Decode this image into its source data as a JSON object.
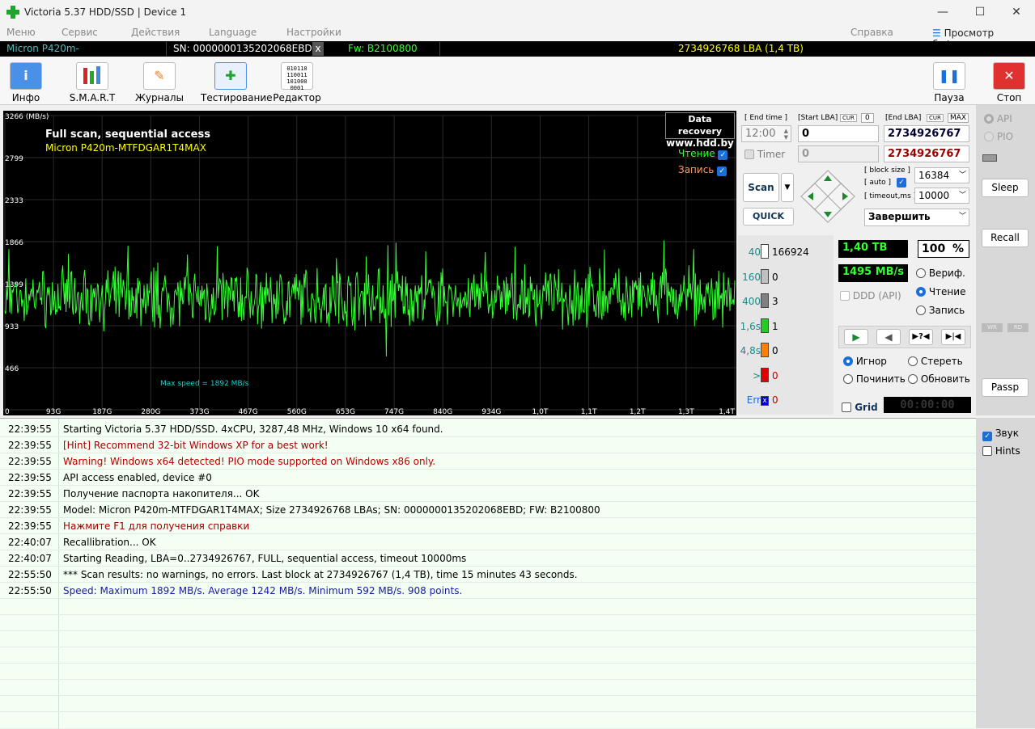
{
  "window": {
    "title": "Victoria 5.37 HDD/SSD | Device 1",
    "min_icon": "minimize-icon",
    "max_icon": "maximize-icon",
    "close_icon": "close-icon"
  },
  "menu": {
    "items": [
      "Меню",
      "Сервис",
      "Действия",
      "Language",
      "Настройки"
    ],
    "help": "Справка",
    "buffer": "Просмотр буфера"
  },
  "device": {
    "model": "Micron P420m-MTFDGAR1T4MAX",
    "sn": "SN: 0000000135202068EBD",
    "x": "x",
    "fw": "Fw: B2100800",
    "lba": "2734926768 LBA (1,4 TB)"
  },
  "toolbar": {
    "buttons": [
      {
        "label": "Инфо",
        "icon": "info-icon"
      },
      {
        "label": "S.M.A.R.T",
        "icon": "smart-icon"
      },
      {
        "label": "Журналы",
        "icon": "journal-icon"
      },
      {
        "label": "Тестирование",
        "icon": "testing-icon"
      },
      {
        "label": "Редактор",
        "icon": "editor-icon"
      }
    ],
    "pause": "Пауза",
    "stop": "Стоп"
  },
  "chart_data": {
    "type": "line",
    "title": "Full scan, sequential access",
    "subtitle": "Micron P420m-MTFDGAR1T4MAX",
    "ylabel": "3266 (MB/s)",
    "ylim": [
      0,
      3266
    ],
    "yticks": [
      "2799",
      "2333",
      "1866",
      "1399",
      "933",
      "466"
    ],
    "xticks": [
      "0",
      "93G",
      "187G",
      "280G",
      "373G",
      "467G",
      "560G",
      "653G",
      "747G",
      "840G",
      "934G",
      "1,0T",
      "1,1T",
      "1,2T",
      "1,3T",
      "1,4T"
    ],
    "max_label": "Max speed = 1892 MB/s",
    "legend": [
      {
        "name": "Чтение",
        "color": "#33ff33",
        "checked": true
      },
      {
        "name": "Запись",
        "color": "#ff9966",
        "checked": true
      }
    ],
    "grid": true,
    "series": [
      {
        "name": "Чтение",
        "color": "#33ff33",
        "points": 908,
        "max": 1892,
        "avg": 1242,
        "min": 592
      }
    ]
  },
  "watermark": {
    "line1": "Data recovery",
    "line2": "www.hdd.by"
  },
  "controls": {
    "end_time_lbl": "[ End time ]",
    "end_time": "12:00",
    "start_lba_lbl": "[Start LBA]",
    "cur": "CUR",
    "cur_val": "0",
    "start_lba": "0",
    "end_lba_lbl": "[End LBA]",
    "max": "MAX",
    "end_lba": "2734926767",
    "end_lba2": "2734926767",
    "timer_lbl": "Timer",
    "timer_val": "0",
    "scan": "Scan",
    "quick": "QUICK",
    "block_size_lbl": "[ block size ]",
    "auto_lbl": "[ auto ]",
    "block_size": "16384",
    "timeout_lbl": "[ timeout,ms ]",
    "timeout": "10000",
    "finish": "Завершить"
  },
  "stats": {
    "blocks": [
      {
        "lbl": "40",
        "val": "166924",
        "color": "#ffffff"
      },
      {
        "lbl": "160",
        "val": "0",
        "color": "#c0c0c0"
      },
      {
        "lbl": "400",
        "val": "3",
        "color": "#808080"
      },
      {
        "lbl": "1,6s",
        "val": "1",
        "color": "#22cc22"
      },
      {
        "lbl": "4,8s",
        "val": "0",
        "color": "#ff8000"
      },
      {
        "lbl": ">",
        "val": "0",
        "color": "#e00000"
      },
      {
        "lbl": "Err",
        "val": "0",
        "color": "#0000cc"
      }
    ]
  },
  "speed": {
    "size": "1,40 TB",
    "percent": "100",
    "pct": "%",
    "rate": "1495 MB/s",
    "ddd": "DDD (API)",
    "verify": "Вериф.",
    "read": "Чтение",
    "write": "Запись",
    "ignore": "Игнор",
    "erase": "Стереть",
    "repair": "Починить",
    "refresh": "Обновить",
    "grid": "Grid",
    "time": "00:00:00"
  },
  "side": {
    "api": "API",
    "pio": "PIO",
    "sleep": "Sleep",
    "recall": "Recall",
    "wr": "WR",
    "rd": "RD",
    "passp": "Passp",
    "sound": "Звук",
    "hints": "Hints"
  },
  "log": [
    {
      "t": "22:39:55",
      "m": "Starting Victoria 5.37 HDD/SSD. 4xCPU, 3287,48 MHz, Windows 10 x64 found.",
      "c": "#000000"
    },
    {
      "t": "22:39:55",
      "m": "[Hint] Recommend 32-bit Windows XP for a best work!",
      "c": "#a00000"
    },
    {
      "t": "22:39:55",
      "m": "Warning! Windows x64 detected! PIO mode supported on Windows x86 only.",
      "c": "#c00000"
    },
    {
      "t": "22:39:55",
      "m": "API access enabled, device #0",
      "c": "#000000"
    },
    {
      "t": "22:39:55",
      "m": "Получение паспорта накопителя... OK",
      "c": "#000000"
    },
    {
      "t": "22:39:55",
      "m": "Model: Micron P420m-MTFDGAR1T4MAX; Size 2734926768 LBAs; SN: 0000000135202068EBD; FW: B2100800",
      "c": "#000000"
    },
    {
      "t": "22:39:55",
      "m": "Нажмите F1 для получения справки",
      "c": "#a00000"
    },
    {
      "t": "22:40:07",
      "m": "Recallibration... OK",
      "c": "#000000"
    },
    {
      "t": "22:40:07",
      "m": "Starting Reading, LBA=0..2734926767, FULL, sequential access, timeout 10000ms",
      "c": "#000000"
    },
    {
      "t": "22:55:50",
      "m": "*** Scan results: no warnings, no errors. Last block at 2734926767 (1,4 TB), time 15 minutes 43 seconds.",
      "c": "#000000"
    },
    {
      "t": "22:55:50",
      "m": "Speed: Maximum 1892 MB/s. Average 1242 MB/s. Minimum 592 MB/s. 908 points.",
      "c": "#1a1aa0"
    }
  ]
}
